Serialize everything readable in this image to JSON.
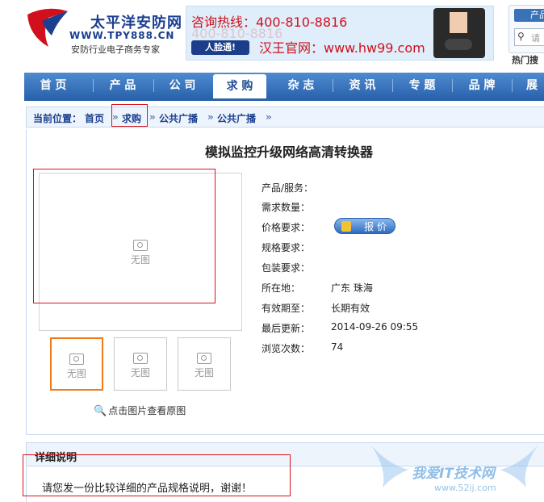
{
  "header": {
    "logo_cn": "太平洋安防网",
    "logo_url": "WWW.TPY888.CN",
    "slogan": "安防行业电子商务专家",
    "banner": {
      "hotline_label": "咨询热线：",
      "hotline_number": "400-810-8816",
      "badge": "人脸通!",
      "site": "汉王官网：www.hw99.com"
    },
    "search": {
      "tab_label": "产品",
      "placeholder": "请"
    },
    "hot_search": "热门搜"
  },
  "nav": {
    "items": [
      "首 页",
      "产 品",
      "公 司",
      "求 购",
      "杂 志",
      "资 讯",
      "专 题",
      "品 牌",
      "展"
    ],
    "active_index": 3
  },
  "breadcrumb": {
    "prefix": "当前位置：",
    "items": [
      "首页",
      "求购",
      "公共广播",
      "公共广播"
    ],
    "sep": "»"
  },
  "product": {
    "title": "模拟监控升级网络高清转换器",
    "no_image_label": "无图",
    "view_original": "点击图片查看原图",
    "fields": [
      {
        "label": "产品/服务：",
        "value": ""
      },
      {
        "label": "需求数量：",
        "value": ""
      },
      {
        "label": "价格要求：",
        "value": ""
      },
      {
        "label": "规格要求：",
        "value": ""
      },
      {
        "label": "包装要求：",
        "value": ""
      },
      {
        "label": "所在地：",
        "value": "广东 珠海"
      },
      {
        "label": "有效期至：",
        "value": "长期有效"
      },
      {
        "label": "最后更新：",
        "value": "2014-09-26 09:55"
      },
      {
        "label": "浏览次数：",
        "value": "74"
      }
    ],
    "price_button": "报 价"
  },
  "detail": {
    "heading": "详细说明",
    "text": "请您发一份比较详细的产品规格说明，谢谢！"
  },
  "watermark": {
    "text": "我爱IT技术网",
    "url": "www.52ij.com"
  },
  "colors": {
    "brand_blue": "#1a3f8f",
    "nav_blue": "#2a63ad",
    "hotline_red": "#d0101c",
    "annotation_red": "#d8141c",
    "selected_thumb": "#f07a1a"
  }
}
